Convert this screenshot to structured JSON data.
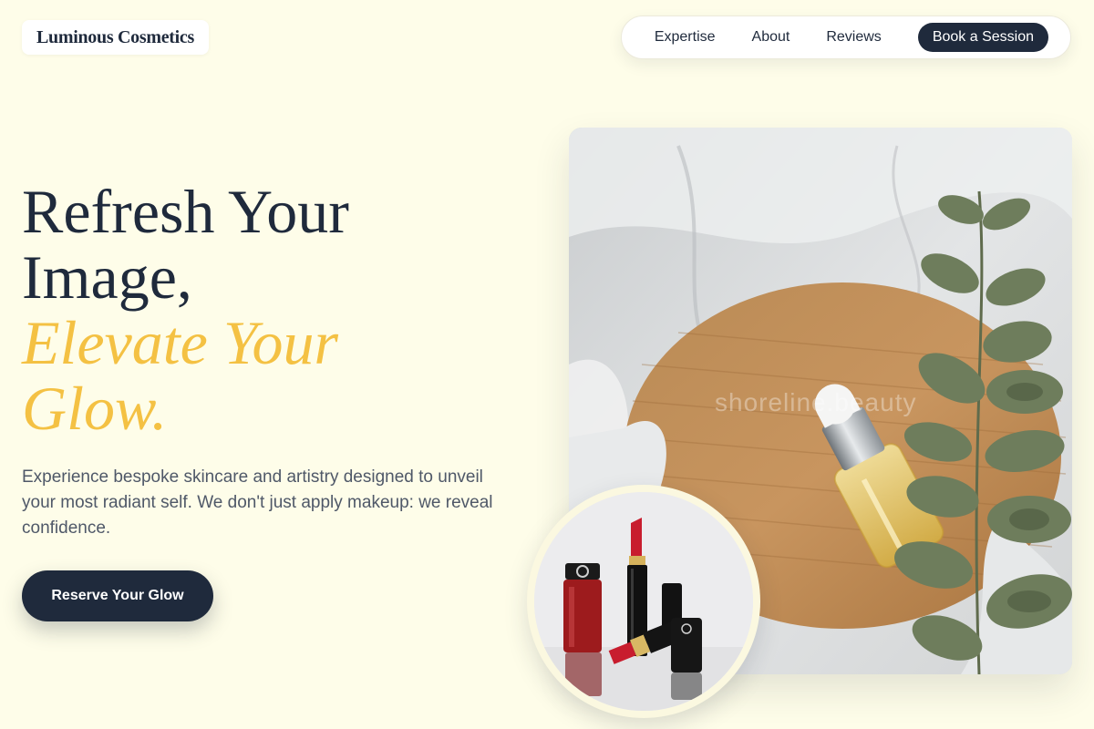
{
  "brand": {
    "name": "Luminous Cosmetics"
  },
  "nav": {
    "links": [
      "Expertise",
      "About",
      "Reviews"
    ],
    "cta_label": "Book a Session"
  },
  "hero": {
    "title_lines": [
      "Refresh Your",
      "Image,"
    ],
    "accent_lines": [
      "Elevate Your",
      "Glow."
    ],
    "description": "Experience bespoke skincare and artistry designed to unveil your most radiant self. We don't just apply makeup: we reveal confidence.",
    "cta_label": "Reserve Your Glow"
  },
  "images": {
    "main_watermark": "shoreline.beauty"
  },
  "colors": {
    "background": "#fefde9",
    "primary_dark": "#1f2a3c",
    "accent_gold": "#f4c143",
    "body_text": "#4f5868"
  }
}
